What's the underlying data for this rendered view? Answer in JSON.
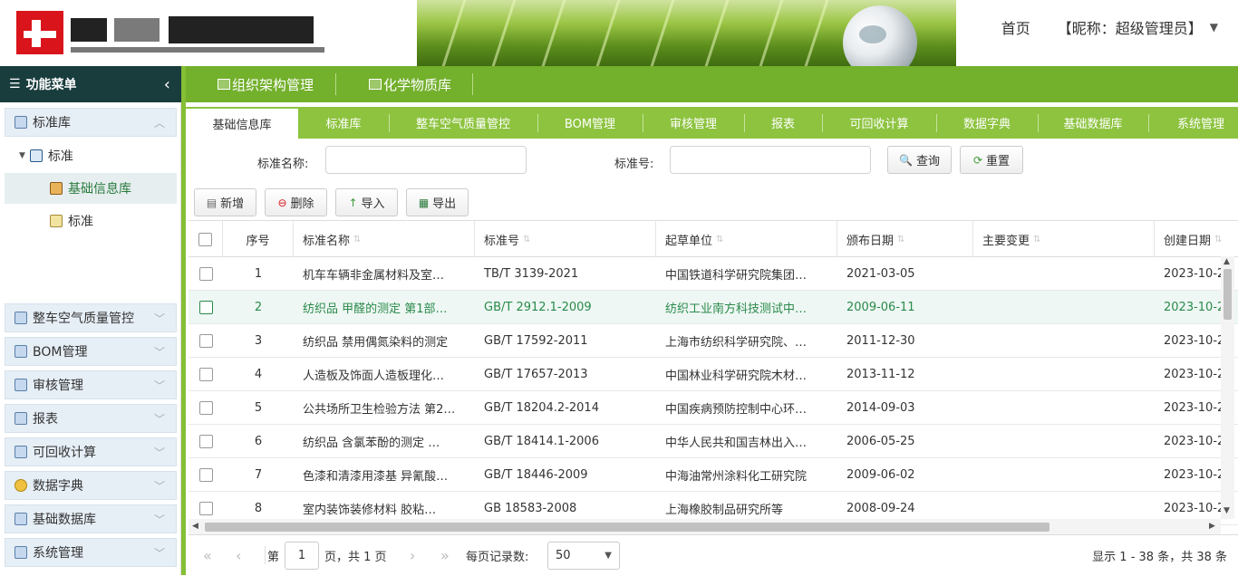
{
  "header": {
    "nav_home": "首页",
    "user_label": "【昵称：超级管理员】",
    "user_caret": "▼"
  },
  "sidebar": {
    "title": "功能菜单",
    "collapse_icon": "‹",
    "open_section": "标准库",
    "tree_parent": "标准",
    "tree_children": [
      "基础信息库",
      "标准"
    ],
    "sections": [
      "整车空气质量管控",
      "BOM管理",
      "审核管理",
      "报表",
      "可回收计算",
      "数据字典",
      "基础数据库",
      "系统管理"
    ]
  },
  "top_tabs": [
    "组织架构管理",
    "化学物质库"
  ],
  "sub_tabs": [
    "基础信息库",
    "标准库",
    "整车空气质量管控",
    "BOM管理",
    "审核管理",
    "报表",
    "可回收计算",
    "数据字典",
    "基础数据库",
    "系统管理"
  ],
  "search": {
    "name_label": "标准名称:",
    "name_value": "",
    "code_label": "标准号:",
    "code_value": "",
    "query_button": "查询",
    "reset_button": "重置"
  },
  "toolbar": {
    "add": "新增",
    "delete": "删除",
    "import": "导入",
    "export": "导出"
  },
  "table": {
    "columns": [
      "序号",
      "标准名称",
      "标准号",
      "起草单位",
      "颁布日期",
      "主要变更",
      "创建日期"
    ],
    "selected_row": 1,
    "rows": [
      {
        "no": "1",
        "name": "机车车辆非金属材料及室…",
        "code": "TB/T 3139-2021",
        "unit": "中国铁道科学研究院集团…",
        "date": "2021-03-05",
        "change": "",
        "created": "2023-10-2"
      },
      {
        "no": "2",
        "name": "纺织品 甲醛的测定 第1部…",
        "code": "GB/T 2912.1-2009",
        "unit": "纺织工业南方科技测试中…",
        "date": "2009-06-11",
        "change": "",
        "created": "2023-10-2"
      },
      {
        "no": "3",
        "name": "纺织品 禁用偶氮染料的测定",
        "code": "GB/T 17592-2011",
        "unit": "上海市纺织科学研究院、…",
        "date": "2011-12-30",
        "change": "",
        "created": "2023-10-2"
      },
      {
        "no": "4",
        "name": "人造板及饰面人造板理化…",
        "code": "GB/T 17657-2013",
        "unit": "中国林业科学研究院木材…",
        "date": "2013-11-12",
        "change": "",
        "created": "2023-10-2"
      },
      {
        "no": "5",
        "name": "公共场所卫生检验方法 第2…",
        "code": "GB/T 18204.2-2014",
        "unit": "中国疾病预防控制中心环…",
        "date": "2014-09-03",
        "change": "",
        "created": "2023-10-2"
      },
      {
        "no": "6",
        "name": "纺织品 含氯苯酚的测定 …",
        "code": "GB/T 18414.1-2006",
        "unit": "中华人民共和国吉林出入…",
        "date": "2006-05-25",
        "change": "",
        "created": "2023-10-2"
      },
      {
        "no": "7",
        "name": "色漆和清漆用漆基 异氰酸…",
        "code": "GB/T 18446-2009",
        "unit": "中海油常州涂料化工研究院",
        "date": "2009-06-02",
        "change": "",
        "created": "2023-10-2"
      },
      {
        "no": "8",
        "name": "室内装饰装修材料 胶粘…",
        "code": "GB 18583-2008",
        "unit": "上海橡胶制品研究所等",
        "date": "2008-09-24",
        "change": "",
        "created": "2023-10-2"
      }
    ]
  },
  "pager": {
    "page_prefix": "第",
    "page_value": "1",
    "page_suffix": "页，共 1 页",
    "per_page_label": "每页记录数:",
    "per_page_value": "50",
    "summary": "显示 1 - 38 条，共 38 条"
  },
  "colors": {
    "sidebar_head": "#193c3d",
    "green_bar": "#73b02c",
    "subtab_green": "#8dc33f",
    "selected_text": "#2a8a4a"
  }
}
